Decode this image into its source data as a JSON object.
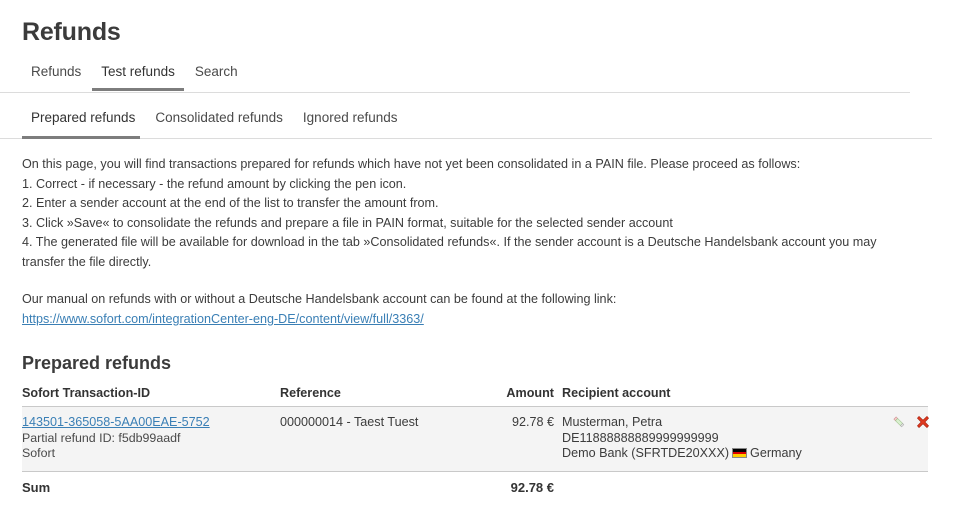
{
  "page": {
    "title": "Refunds"
  },
  "tabs_primary": [
    {
      "label": "Refunds",
      "active": false
    },
    {
      "label": "Test refunds",
      "active": true
    },
    {
      "label": "Search",
      "active": false
    }
  ],
  "tabs_secondary": [
    {
      "label": "Prepared refunds",
      "active": true
    },
    {
      "label": "Consolidated refunds",
      "active": false
    },
    {
      "label": "Ignored refunds",
      "active": false
    }
  ],
  "instructions": {
    "intro": "On this page, you will find transactions prepared for refunds which have not yet been consolidated in a PAIN file. Please proceed as follows:",
    "steps": [
      "1. Correct - if necessary - the refund amount by clicking the pen icon.",
      "2. Enter a sender account at the end of the list to transfer the amount from.",
      "3. Click »Save« to consolidate the refunds and prepare a file in PAIN format, suitable for the selected sender account",
      "4. The generated file will be available for download in the tab »Consolidated refunds«. If the sender account is a Deutsche Handelsbank account you may transfer the file directly."
    ]
  },
  "manual": {
    "text": "Our manual on refunds with or without a Deutsche Handelsbank account can be found at the following link:",
    "link_label": "https://www.sofort.com/integrationCenter-eng-DE/content/view/full/3363/"
  },
  "table": {
    "section_title": "Prepared refunds",
    "headers": {
      "transaction_id": "Sofort Transaction-ID",
      "reference": "Reference",
      "amount": "Amount",
      "recipient_account": "Recipient account",
      "actions": ""
    },
    "rows": [
      {
        "transaction_id": "143501-365058-5AA00EAE-5752",
        "partial_refund": "Partial refund ID: f5db99aadf",
        "provider": "Sofort",
        "reference": "000000014 - Taest Tuest",
        "amount": "92.78 €",
        "recipient_name": "Musterman, Petra",
        "recipient_iban": "DE11888888889999999999",
        "recipient_bank": "Demo Bank (SFRTDE20XXX)",
        "recipient_country": "Germany",
        "country_flag": "flag-germany-icon",
        "edit_icon": "pencil-icon",
        "delete_icon": "delete-x-icon"
      }
    ],
    "sum": {
      "label": "Sum",
      "amount": "92.78 €"
    }
  },
  "colors": {
    "link": "#3a7fb5",
    "active_tab_underline": "#7d7d7d",
    "row_background": "#f4f4f4",
    "delete_icon": "#e03a20",
    "text": "#3c3c3c"
  }
}
